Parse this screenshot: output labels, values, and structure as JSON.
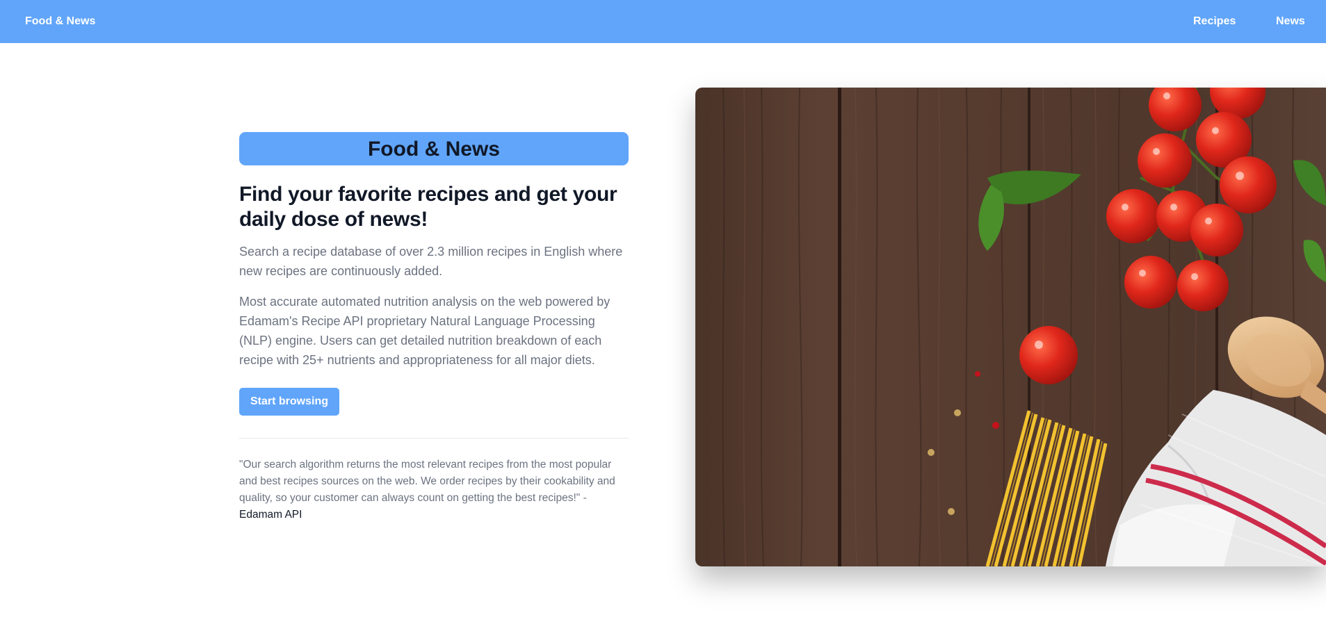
{
  "navbar": {
    "brand": "Food & News",
    "links": [
      "Recipes",
      "News"
    ]
  },
  "hero": {
    "title_pill": "Food & News",
    "headline": "Find your favorite recipes and get your daily dose of news!",
    "paragraph1": "Search a recipe database of over 2.3 million recipes in English where new recipes are continuously added.",
    "paragraph2": "Most accurate automated nutrition analysis on the web powered by Edamam's Recipe API proprietary Natural Language Processing (NLP) engine. Users can get detailed nutrition breakdown of each recipe with 25+ nutrients and appropriateness for all major diets.",
    "cta_label": "Start browsing",
    "quote": "\"Our search algorithm returns the most relevant recipes from the most popular and best recipes sources on the web. We order recipes by their cookability and quality, so your customer can always count on getting the best recipes!\" - ",
    "quote_author": "Edamam API"
  },
  "colors": {
    "accent": "#60a5fa",
    "heading": "#111827",
    "body_text": "#6b7280"
  }
}
